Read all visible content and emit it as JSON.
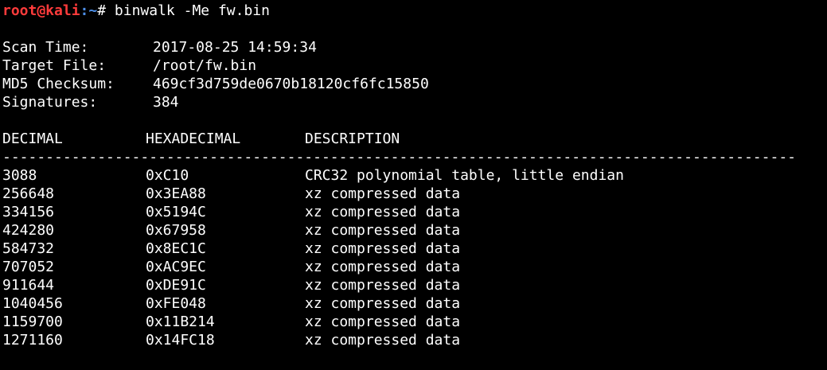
{
  "prompt": {
    "user_host": "root@kali",
    "path": ":~",
    "symbol": "#",
    "command": " binwalk -Me fw.bin"
  },
  "info": [
    {
      "key": "Scan Time:",
      "value": "2017-08-25 14:59:34"
    },
    {
      "key": "Target File:",
      "value": "/root/fw.bin"
    },
    {
      "key": "MD5 Checksum:",
      "value": "469cf3d759de0670b18120cf6fc15850"
    },
    {
      "key": "Signatures:",
      "value": "384"
    }
  ],
  "table": {
    "headers": [
      "DECIMAL",
      "HEXADECIMAL",
      "DESCRIPTION"
    ],
    "separator": "--------------------------------------------------------------------------------------------",
    "rows": [
      [
        "3088",
        "0xC10",
        "CRC32 polynomial table, little endian"
      ],
      [
        "256648",
        "0x3EA88",
        "xz compressed data"
      ],
      [
        "334156",
        "0x5194C",
        "xz compressed data"
      ],
      [
        "424280",
        "0x67958",
        "xz compressed data"
      ],
      [
        "584732",
        "0x8EC1C",
        "xz compressed data"
      ],
      [
        "707052",
        "0xAC9EC",
        "xz compressed data"
      ],
      [
        "911644",
        "0xDE91C",
        "xz compressed data"
      ],
      [
        "1040456",
        "0xFE048",
        "xz compressed data"
      ],
      [
        "1159700",
        "0x11B214",
        "xz compressed data"
      ],
      [
        "1271160",
        "0x14FC18",
        "xz compressed data"
      ]
    ]
  },
  "colors": {
    "background": "#000000",
    "text": "#ffffff",
    "prompt_user": "#ff3b3b",
    "prompt_path": "#4d8fe8"
  }
}
